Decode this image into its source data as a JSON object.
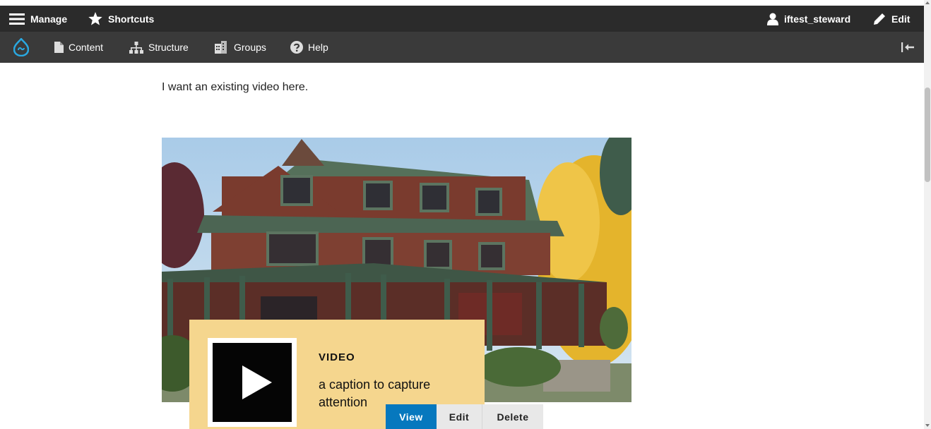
{
  "toolbar": {
    "manage_label": "Manage",
    "shortcuts_label": "Shortcuts",
    "user_label": "iftest_steward",
    "edit_label": "Edit"
  },
  "admin_menu": {
    "items": [
      {
        "label": "Content",
        "icon": "file-icon"
      },
      {
        "label": "Structure",
        "icon": "sitemap-icon"
      },
      {
        "label": "Groups",
        "icon": "buildings-icon"
      },
      {
        "label": "Help",
        "icon": "help-icon"
      }
    ]
  },
  "content": {
    "intro_text": "I want an existing video here."
  },
  "media_card": {
    "type_label": "VIDEO",
    "caption": "a caption to capture attention"
  },
  "actions": {
    "view_label": "View",
    "edit_label": "Edit",
    "delete_label": "Delete"
  },
  "colors": {
    "toolbar_dark": "#2b2b2b",
    "toolbar_sub": "#3a3a3a",
    "card_bg": "#f5d68e",
    "view_button": "#0678be"
  }
}
